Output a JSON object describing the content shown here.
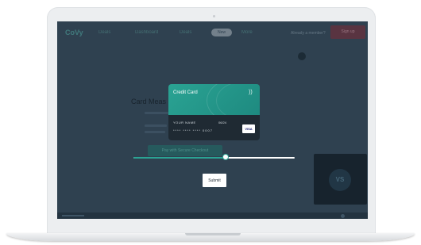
{
  "nav": {
    "logo": "CoVy",
    "items": [
      "Deals",
      "Dashboard",
      "Deals",
      "More"
    ],
    "pill": "New",
    "login": "Already a member?",
    "signup": "Sign up"
  },
  "background": {
    "title": "Card Meas",
    "button": "Pay with Secure Checkout",
    "video_badge": "VS"
  },
  "card": {
    "title": "Credit Card",
    "name": "YOUR NAME",
    "expiry": "06/24",
    "number": "**** **** **** 0007",
    "brand": "VISA"
  },
  "slider": {
    "value_fraction": 0.57
  },
  "actions": {
    "submit": "Submit"
  },
  "colors": {
    "accent": "#2aa393",
    "screen": "#2f4150",
    "card_dark": "#1f2a33"
  }
}
